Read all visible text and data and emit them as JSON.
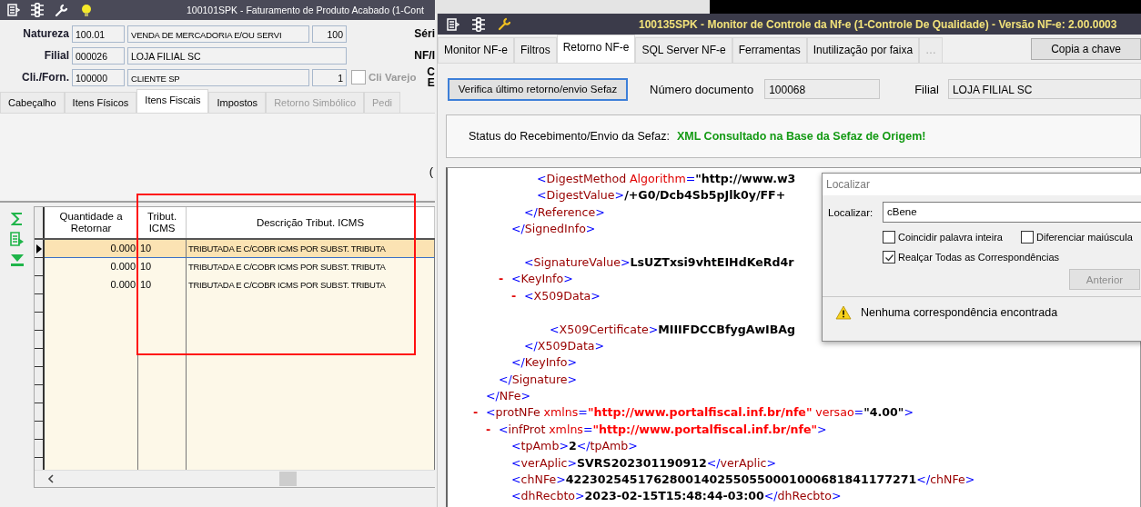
{
  "left_window": {
    "title": "100101SPK - Faturamento de Produto Acabado (1-Cont",
    "form": [
      {
        "label": "Natureza",
        "code": "100.01",
        "name": "VENDA DE MERCADORIA E/OU SERVI",
        "extra": "100",
        "side_label": "Séri"
      },
      {
        "label": "Filial",
        "code": "000026",
        "name": "LOJA FILIAL SC",
        "side_label": "NF/I"
      },
      {
        "label": "Cli./Forn.",
        "code": "100000",
        "name": "CLIENTE SP",
        "extra": "1",
        "checkbox": {
          "label": "Cli Varejo",
          "checked": false
        },
        "side_label": "C E"
      }
    ],
    "tabs": [
      {
        "label": "Cabeçalho",
        "selected": false,
        "disabled": false
      },
      {
        "label": "Itens Físicos",
        "selected": false,
        "disabled": false
      },
      {
        "label": "Itens Fiscais",
        "selected": true,
        "disabled": false
      },
      {
        "label": "Impostos",
        "selected": false,
        "disabled": false
      },
      {
        "label": "Retorno Simbólico",
        "selected": false,
        "disabled": true
      },
      {
        "label": "Pedi",
        "selected": false,
        "disabled": true
      }
    ],
    "panel_text": "(",
    "grid": {
      "columns": [
        "Quantidade a Retornar",
        "Tribut. ICMS",
        "Descrição Tribut. ICMS"
      ],
      "rows": [
        {
          "qty": "0.000",
          "code": "10",
          "desc": "TRIBUTADA E C/COBR ICMS POR SUBST. TRIBUTA",
          "selected": true
        },
        {
          "qty": "0.000",
          "code": "10",
          "desc": "TRIBUTADA E C/COBR ICMS POR SUBST. TRIBUTA",
          "selected": false
        },
        {
          "qty": "0.000",
          "code": "10",
          "desc": "TRIBUTADA E C/COBR ICMS POR SUBST. TRIBUTA",
          "selected": false
        }
      ]
    }
  },
  "right_window": {
    "title": "100135SPK - Monitor de Controle da Nf-e (1-Controle De Qualidade) - Versão NF-e: 2.00.0003",
    "tabs": [
      {
        "label": "Monitor NF-e",
        "selected": false,
        "disabled": false
      },
      {
        "label": "Filtros",
        "selected": false,
        "disabled": false
      },
      {
        "label": "Retorno NF-e",
        "selected": true,
        "disabled": false
      },
      {
        "label": "SQL Server NF-e",
        "selected": false,
        "disabled": false
      },
      {
        "label": "Ferramentas",
        "selected": false,
        "disabled": false
      },
      {
        "label": "Inutilização por faixa",
        "selected": false,
        "disabled": false
      },
      {
        "label": "…",
        "selected": false,
        "disabled": true
      }
    ],
    "copy_button": "Copia a chave",
    "check_button": "Verifica último retorno/envio Sefaz",
    "document_label": "Número documento",
    "document_value": "100068",
    "branch_label": "Filial",
    "branch_value": "LOJA FILIAL SC",
    "status_label": "Status do Recebimento/Envio da Sefaz:",
    "status_value": "XML Consultado na Base da Sefaz de Origem!",
    "xml": [
      {
        "close": [
          {
            "kind": "mark",
            "t": "</"
          },
          {
            "kind": "tag",
            "t": "NFe"
          },
          {
            "kind": "mark",
            "t": ">"
          }
        ],
        "children": [
          {
            "close": [
              {
                "kind": "mark",
                "t": "</"
              },
              {
                "kind": "tag",
                "t": "Signature"
              },
              {
                "kind": "mark",
                "t": ">"
              }
            ],
            "children": [
              {
                "close": [
                  {
                    "kind": "mark",
                    "t": "</"
                  },
                  {
                    "kind": "tag",
                    "t": "SignedInfo"
                  },
                  {
                    "kind": "mark",
                    "t": ">"
                  }
                ],
                "children": [
                  {
                    "close": [
                      {
                        "kind": "mark",
                        "t": "</"
                      },
                      {
                        "kind": "tag",
                        "t": "Reference"
                      },
                      {
                        "kind": "mark",
                        "t": ">"
                      }
                    ],
                    "children": [
                      {
                        "open": [
                          {
                            "kind": "mark",
                            "t": "<"
                          },
                          {
                            "kind": "tag",
                            "t": "DigestMethod"
                          },
                          {
                            "kind": "attr",
                            "t": "Algorithm"
                          },
                          {
                            "kind": "mark",
                            "t": "="
                          },
                          {
                            "kind": "value",
                            "t": "\"http://www.w3"
                          }
                        ]
                      },
                      {
                        "open": [
                          {
                            "kind": "mark",
                            "t": "<"
                          },
                          {
                            "kind": "tag",
                            "t": "DigestValue"
                          },
                          {
                            "kind": "mark",
                            "t": ">"
                          },
                          {
                            "kind": "value",
                            "t": "/+G0/Dcb4Sb5pJlk0y/FF+"
                          }
                        ]
                      }
                    ]
                  }
                ]
              },
              {
                "kind": "long",
                "open": [
                  {
                    "kind": "mark",
                    "t": "<"
                  },
                  {
                    "kind": "tag",
                    "t": "SignatureValue"
                  },
                  {
                    "kind": "mark",
                    "t": ">"
                  },
                  {
                    "kind": "value",
                    "t": "LsUZTxsi9vhtEIHdKeRd4r"
                  }
                ]
              },
              {
                "toggle": "-",
                "open": [
                  {
                    "kind": "mark",
                    "t": "<"
                  },
                  {
                    "kind": "tag",
                    "t": "KeyInfo"
                  },
                  {
                    "kind": "mark",
                    "t": ">"
                  }
                ],
                "close": [
                  {
                    "kind": "mark",
                    "t": "</"
                  },
                  {
                    "kind": "tag",
                    "t": "KeyInfo"
                  },
                  {
                    "kind": "mark",
                    "t": ">"
                  }
                ],
                "children": [
                  {
                    "toggle": "-",
                    "open": [
                      {
                        "kind": "mark",
                        "t": "<"
                      },
                      {
                        "kind": "tag",
                        "t": "X509Data"
                      },
                      {
                        "kind": "mark",
                        "t": ">"
                      }
                    ],
                    "close": [
                      {
                        "kind": "mark",
                        "t": "</"
                      },
                      {
                        "kind": "tag",
                        "t": "X509Data"
                      },
                      {
                        "kind": "mark",
                        "t": ">"
                      }
                    ],
                    "children": [
                      {
                        "kind": "long",
                        "open": [
                          {
                            "kind": "mark",
                            "t": "<"
                          },
                          {
                            "kind": "tag",
                            "t": "X509Certificate"
                          },
                          {
                            "kind": "mark",
                            "t": ">"
                          },
                          {
                            "kind": "value",
                            "t": "MIIIFDCCBfygAwIBAg"
                          }
                        ]
                      }
                    ]
                  }
                ]
              }
            ]
          }
        ]
      },
      {
        "toggle": "-",
        "open": [
          {
            "kind": "mark",
            "t": "<"
          },
          {
            "kind": "tag",
            "t": "protNFe"
          },
          {
            "kind": "attr",
            "t": "xmlns"
          },
          {
            "kind": "mark",
            "t": "="
          },
          {
            "kind": "ns",
            "t": "\"http://www.portalfiscal.inf.br/nfe\""
          },
          {
            "kind": "attr",
            "t": "versao"
          },
          {
            "kind": "mark",
            "t": "="
          },
          {
            "kind": "value",
            "t": "\"4.00\""
          },
          {
            "kind": "mark",
            "t": ">"
          }
        ],
        "children": [
          {
            "toggle": "-",
            "open": [
              {
                "kind": "mark",
                "t": "<"
              },
              {
                "kind": "tag",
                "t": "infProt"
              },
              {
                "kind": "attr",
                "t": "xmlns"
              },
              {
                "kind": "mark",
                "t": "="
              },
              {
                "kind": "ns",
                "t": "\"http://www.portalfiscal.inf.br/nfe\""
              },
              {
                "kind": "mark",
                "t": ">"
              }
            ],
            "children": [
              {
                "open": [
                  {
                    "kind": "mark",
                    "t": "<"
                  },
                  {
                    "kind": "tag",
                    "t": "tpAmb"
                  },
                  {
                    "kind": "mark",
                    "t": ">"
                  },
                  {
                    "kind": "value",
                    "t": "2"
                  },
                  {
                    "kind": "mark",
                    "t": "</"
                  },
                  {
                    "kind": "tag",
                    "t": "tpAmb"
                  },
                  {
                    "kind": "mark",
                    "t": ">"
                  }
                ]
              },
              {
                "open": [
                  {
                    "kind": "mark",
                    "t": "<"
                  },
                  {
                    "kind": "tag",
                    "t": "verAplic"
                  },
                  {
                    "kind": "mark",
                    "t": ">"
                  },
                  {
                    "kind": "value",
                    "t": "SVRS202301190912"
                  },
                  {
                    "kind": "mark",
                    "t": "</"
                  },
                  {
                    "kind": "tag",
                    "t": "verAplic"
                  },
                  {
                    "kind": "mark",
                    "t": ">"
                  }
                ]
              },
              {
                "open": [
                  {
                    "kind": "mark",
                    "t": "<"
                  },
                  {
                    "kind": "tag",
                    "t": "chNFe"
                  },
                  {
                    "kind": "mark",
                    "t": ">"
                  },
                  {
                    "kind": "value",
                    "t": "42230254517628001402550550001000681841177271"
                  },
                  {
                    "kind": "mark",
                    "t": "</"
                  },
                  {
                    "kind": "tag",
                    "t": "chNFe"
                  },
                  {
                    "kind": "mark",
                    "t": ">"
                  }
                ]
              },
              {
                "open": [
                  {
                    "kind": "mark",
                    "t": "<"
                  },
                  {
                    "kind": "tag",
                    "t": "dhRecbto"
                  },
                  {
                    "kind": "mark",
                    "t": ">"
                  },
                  {
                    "kind": "value",
                    "t": "2023-02-15T15:48:44-03:00"
                  },
                  {
                    "kind": "mark",
                    "t": "</"
                  },
                  {
                    "kind": "tag",
                    "t": "dhRecbto"
                  },
                  {
                    "kind": "mark",
                    "t": ">"
                  }
                ]
              }
            ]
          }
        ]
      }
    ]
  },
  "find_dialog": {
    "title": "Localizar",
    "field_label": "Localizar:",
    "value": "cBene",
    "options": [
      {
        "label": "Coincidir palavra inteira",
        "checked": false
      },
      {
        "label": "Diferenciar maiúscula",
        "checked": false
      },
      {
        "label": "Realçar Todas as Correspondências",
        "checked": true
      }
    ],
    "button": {
      "label": "Anterior",
      "disabled": true
    },
    "message": "Nenhuma correspondência encontrada"
  }
}
